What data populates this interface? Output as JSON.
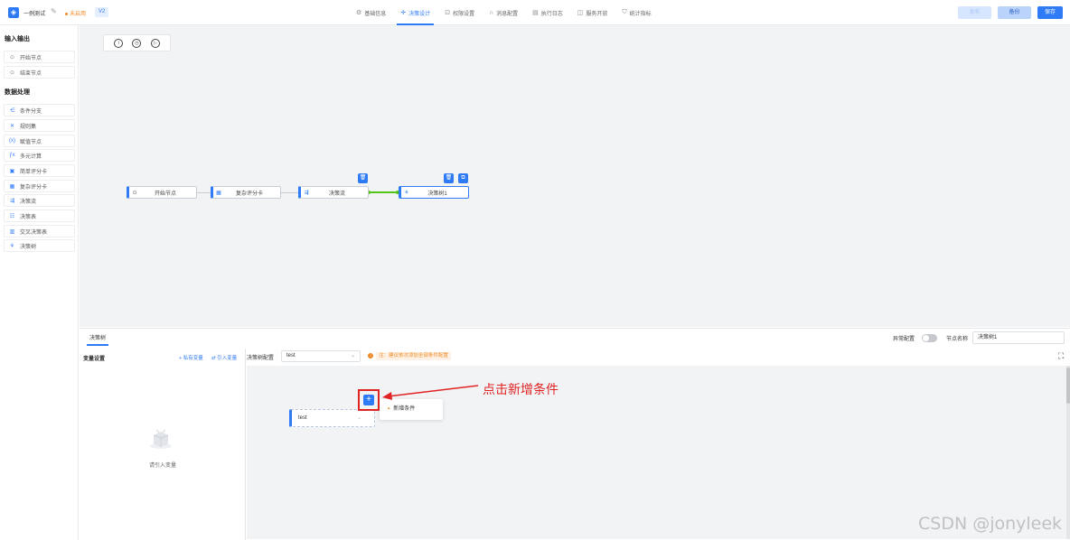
{
  "header": {
    "app_name": "一例测试",
    "status": "未启用",
    "version": "V2",
    "tabs": [
      {
        "label": "基础信息",
        "icon": "gear-icon"
      },
      {
        "label": "决策设计",
        "icon": "plus-icon"
      },
      {
        "label": "权限设置",
        "icon": "lock-icon"
      },
      {
        "label": "消息配置",
        "icon": "headset-icon"
      },
      {
        "label": "执行日志",
        "icon": "doc-icon"
      },
      {
        "label": "服务开放",
        "icon": "box-icon"
      },
      {
        "label": "统计指标",
        "icon": "shield-icon"
      }
    ],
    "publish_label": "发布",
    "backup_label": "备份",
    "save_label": "保存"
  },
  "sidebar": {
    "group_io": "输入输出",
    "io_items": [
      "开始节点",
      "结束节点"
    ],
    "group_data": "数据处理",
    "data_items": [
      "条件分支",
      "规则集",
      "赋值节点",
      "多元计算",
      "简单评分卡",
      "复杂评分卡",
      "决策流",
      "决策表",
      "交叉决策表",
      "决策树"
    ]
  },
  "canvas": {
    "zoom_buttons": [
      "i",
      "◷",
      "▷"
    ],
    "nodes": [
      "开始节点",
      "复杂评分卡",
      "决策流",
      "决策树1"
    ]
  },
  "bottom": {
    "tab_label": "决策树",
    "exception_label": "异常配置",
    "node_name_label": "节点名称",
    "node_name_value": "决策树1",
    "var_title": "变量设置",
    "private_var": "+ 私有变量",
    "import_var": "⇄ 引入变量",
    "empty_text": "请引入变量",
    "tree_config_label": "决策树配置",
    "tree_select_value": "test",
    "tip": "注：建议依次添加全部条件配置",
    "tree_node_value": "test",
    "menu_item": "新增条件",
    "annotation": "点击新增条件"
  },
  "watermark": "CSDN @jonyleek",
  "colors": {
    "accent": "#2f7bf5",
    "warning": "#f08a24",
    "annotation": "#e02424",
    "success": "#52c41a"
  }
}
